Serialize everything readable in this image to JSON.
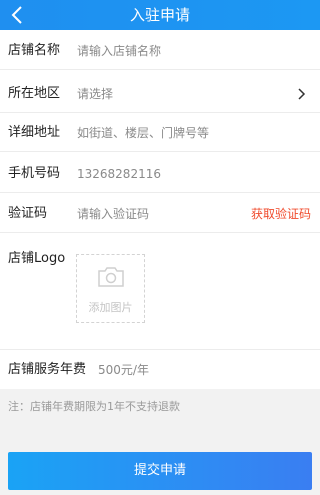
{
  "header": {
    "title": "入驻申请",
    "back_icon": "chevron-left-icon"
  },
  "form": {
    "store_name": {
      "label": "店铺名称",
      "placeholder": "请输入店铺名称"
    },
    "region": {
      "label": "所在地区",
      "placeholder": "请选择",
      "icon": "chevron-right-icon"
    },
    "address": {
      "label": "详细地址",
      "placeholder": "如街道、楼层、门牌号等"
    },
    "phone": {
      "label": "手机号码",
      "value": "13268282116"
    },
    "code": {
      "label": "验证码",
      "placeholder": "请输入验证码",
      "action": "获取验证码"
    },
    "logo": {
      "label": "店铺Logo",
      "upload_text": "添加图片",
      "icon": "camera-icon"
    },
    "fee": {
      "label": "店铺服务年费",
      "value": "500元/年"
    }
  },
  "note": "注：店铺年费期限为1年不支持退款",
  "submit_label": "提交申请",
  "colors": {
    "primary": "#1f8ff0",
    "action": "#f04b2d",
    "button_end": "#3a7ef2"
  }
}
